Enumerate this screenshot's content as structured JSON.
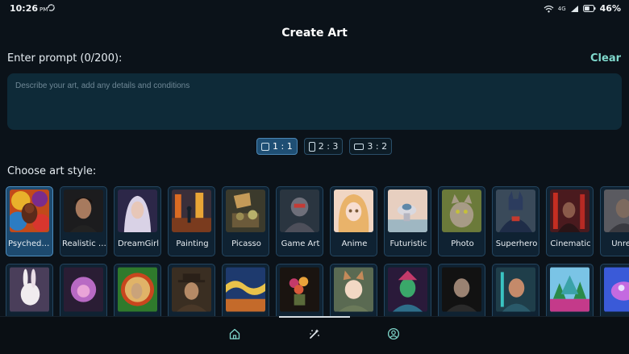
{
  "status_bar": {
    "time": "10:26",
    "ampm": "PM",
    "network": "4G",
    "battery": "46%",
    "icons": [
      "sync-icon",
      "wifi-icon",
      "signal-icon",
      "battery-icon"
    ]
  },
  "header": {
    "title": "Create Art"
  },
  "prompt": {
    "label": "Enter prompt (0/200):",
    "clear_label": "Clear",
    "placeholder": "Describe your art, add any details and conditions",
    "value": ""
  },
  "aspect_ratios": [
    {
      "label": "1 : 1",
      "selected": true
    },
    {
      "label": "2 : 3",
      "selected": false
    },
    {
      "label": "3 : 2",
      "selected": false
    }
  ],
  "art_style": {
    "label": "Choose art style:",
    "row1": [
      {
        "label": "Psychedelic",
        "selected": true
      },
      {
        "label": "Realistic Portrait",
        "selected": false
      },
      {
        "label": "DreamGirl",
        "selected": false
      },
      {
        "label": "Painting",
        "selected": false
      },
      {
        "label": "Picasso",
        "selected": false
      },
      {
        "label": "Game Art",
        "selected": false
      },
      {
        "label": "Anime",
        "selected": false
      },
      {
        "label": "Futuristic",
        "selected": false
      },
      {
        "label": "Photo",
        "selected": false
      },
      {
        "label": "Superhero",
        "selected": false
      },
      {
        "label": "Cinematic",
        "selected": false
      },
      {
        "label": "Unreal",
        "selected": false
      }
    ],
    "row2_count": 12
  },
  "bottom_nav": {
    "items": [
      "home-icon",
      "magic-wand-icon",
      "profile-icon"
    ],
    "active": "magic-wand-icon"
  },
  "colors": {
    "background": "#0b1219",
    "accent": "#7fd8cc",
    "selected": "#1d4a6f",
    "input_bg": "#0e2a38"
  }
}
